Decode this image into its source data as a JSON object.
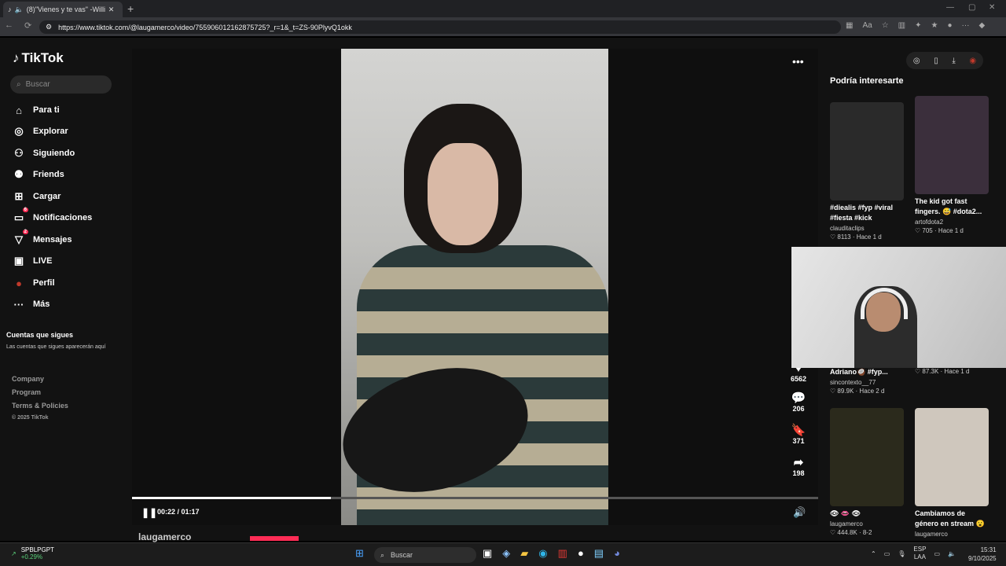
{
  "browser": {
    "tab_title": "(8)\"Vienes y te vas\" -William",
    "url": "https://www.tiktok.com/@laugamerco/video/755906012162875725?_r=1&_t=ZS-90PlyvQ1okk",
    "new_tab": "+",
    "nav": {
      "back": "←",
      "reload": "⟳"
    },
    "window": {
      "minimize": "—",
      "maximize": "▢",
      "close": "✕"
    }
  },
  "sidebar": {
    "logo": "TikTok",
    "search_placeholder": "Buscar",
    "items": [
      {
        "label": "Para ti",
        "icon": "home-icon",
        "glyph": "⌂"
      },
      {
        "label": "Explorar",
        "icon": "compass-icon",
        "glyph": "◎"
      },
      {
        "label": "Siguiendo",
        "icon": "following-icon",
        "glyph": "⚇"
      },
      {
        "label": "Friends",
        "icon": "friends-icon",
        "glyph": "⚉"
      },
      {
        "label": "Cargar",
        "icon": "upload-icon",
        "glyph": "⊞"
      },
      {
        "label": "Notificaciones",
        "icon": "notifications-icon",
        "glyph": "▭",
        "badge": "6"
      },
      {
        "label": "Mensajes",
        "icon": "messages-icon",
        "glyph": "▽",
        "badge": "2"
      },
      {
        "label": "LIVE",
        "icon": "live-icon",
        "glyph": "▣"
      },
      {
        "label": "Perfil",
        "icon": "profile-icon",
        "glyph": "●"
      },
      {
        "label": "Más",
        "icon": "more-icon",
        "glyph": "···"
      }
    ],
    "following_title": "Cuentas que sigues",
    "following_desc": "Las cuentas que sigues aparecerán aquí",
    "footer": [
      "Company",
      "Program",
      "Terms & Policies"
    ],
    "copyright": "© 2025 TikTok"
  },
  "player": {
    "time": "00:22 / 01:17",
    "progress": 0.29,
    "pause_glyph": "❚❚",
    "volume_glyph": "🔊",
    "more_glyph": "•••",
    "author": "laugamerco",
    "actions": [
      {
        "name": "like",
        "glyph": "♥",
        "count": "6562"
      },
      {
        "name": "comment",
        "glyph": "💬",
        "count": "206"
      },
      {
        "name": "bookmark",
        "glyph": "🔖",
        "count": "371"
      },
      {
        "name": "share",
        "glyph": "➦",
        "count": "198"
      }
    ]
  },
  "recommend": {
    "title": "Podría interesarte",
    "cards": [
      {
        "caption": "#diealis #fyp #viral #fiesta #kick",
        "author": "clauditaclips",
        "stats": "♡ 8113 · Hace 1 d",
        "color": "#2a2a2a"
      },
      {
        "caption": "The kid got fast fingers. 😅 #dota2...",
        "author": "artofdota2",
        "stats": "♡ 705 · Hace 1 d",
        "color": "#3b2f3c"
      },
      {
        "caption": "Adriano🥥 #fyp...",
        "author": "sincontexto__77",
        "stats": "♡ 89.9K · Hace 2 d",
        "color": "#222"
      },
      {
        "caption": "",
        "author": "",
        "stats": "♡ 87.3K · Hace 1 d",
        "color": "#222"
      },
      {
        "caption": "👁 👄 👁",
        "author": "laugamerco",
        "stats": "♡ 444.8K · 8-2",
        "color": "#2b2a1c"
      },
      {
        "caption": "Cambiamos de género en stream 😮",
        "author": "laugamerco",
        "stats": "",
        "color": "#cfc7bd"
      }
    ],
    "top_icons": [
      "◎",
      "▯",
      "⤓",
      "◉"
    ]
  },
  "taskbar": {
    "stock_name": "SPBLPGPT",
    "stock_change": "+0.29%",
    "search": "Buscar",
    "lang": "ESP",
    "region": "LAA",
    "time": "15:31",
    "date": "9/10/2025"
  }
}
